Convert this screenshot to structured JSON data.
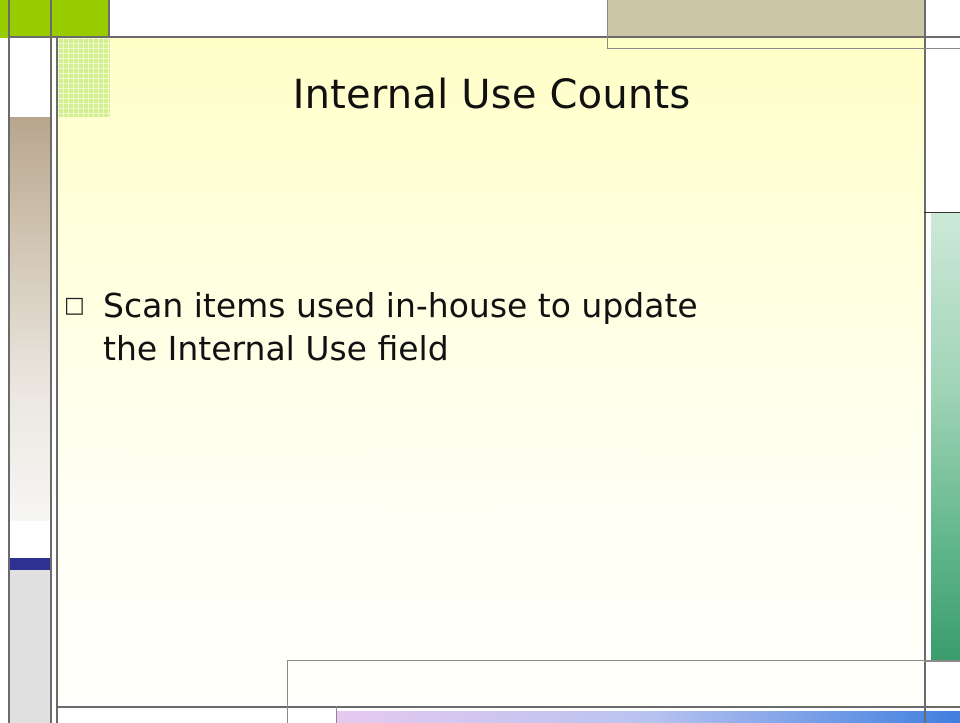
{
  "slide": {
    "title": "Internal Use Counts",
    "bullets": [
      {
        "marker": "□",
        "text_line1": "Scan items used in-house to update",
        "text_line2": "the Internal Use field"
      }
    ]
  },
  "theme": {
    "accent_green": "#99cc00",
    "accent_tan": "#cbc6a6",
    "accent_blue": "#2e3192",
    "panel_background": "#ffffc8"
  }
}
